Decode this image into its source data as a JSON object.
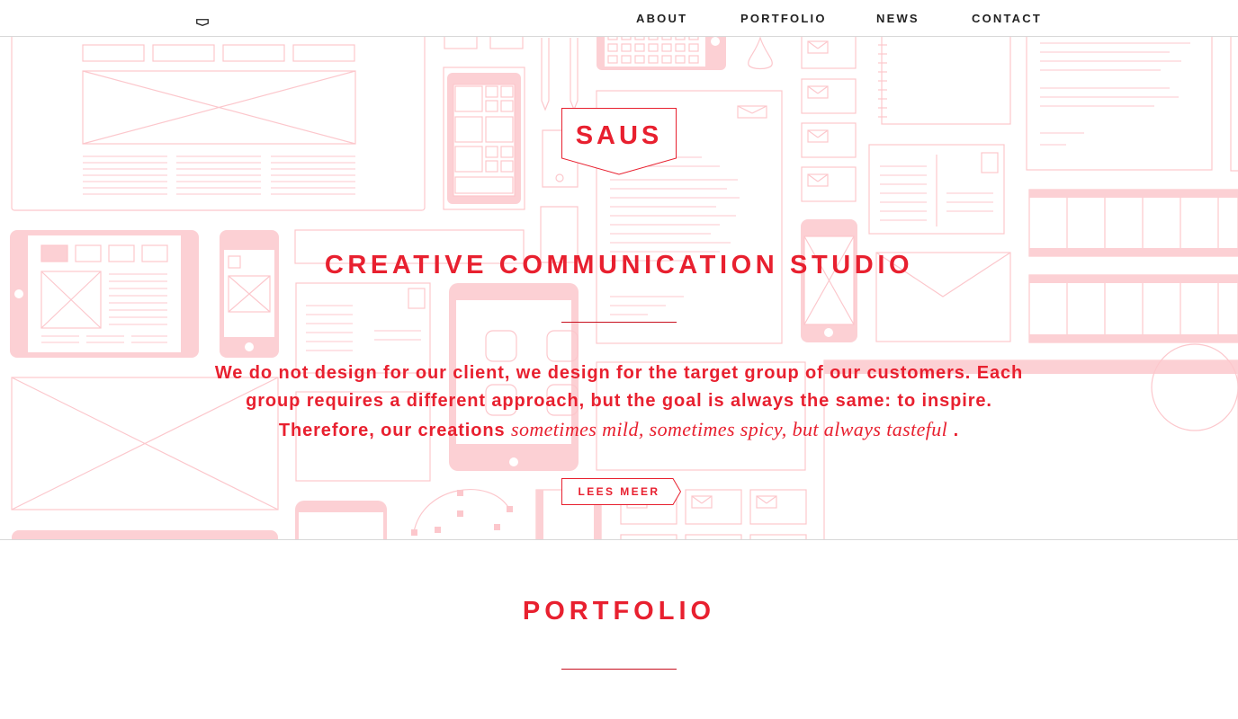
{
  "header": {
    "logo_icon": "shield-badge-icon",
    "nav": [
      {
        "label": "ABOUT"
      },
      {
        "label": "PORTFOLIO"
      },
      {
        "label": "NEWS"
      },
      {
        "label": "CONTACT"
      }
    ]
  },
  "hero": {
    "badge_text": "SAUS",
    "tagline": "CREATIVE COMMUNICATION STUDIO",
    "intro_lead": "We do not design for our client, we design for the target group of our customers. Each group requires a different approach, but the goal is always the same: to inspire. Therefore, our creations ",
    "intro_italic": "sometimes mild, sometimes spicy, but always tasteful",
    "intro_end": " .",
    "button_label": "LEES MEER"
  },
  "portfolio": {
    "title": "PORTFOLIO"
  },
  "colors": {
    "accent": "#e8202f",
    "illustration": "#fcd0d4",
    "nav_text": "#222222"
  }
}
